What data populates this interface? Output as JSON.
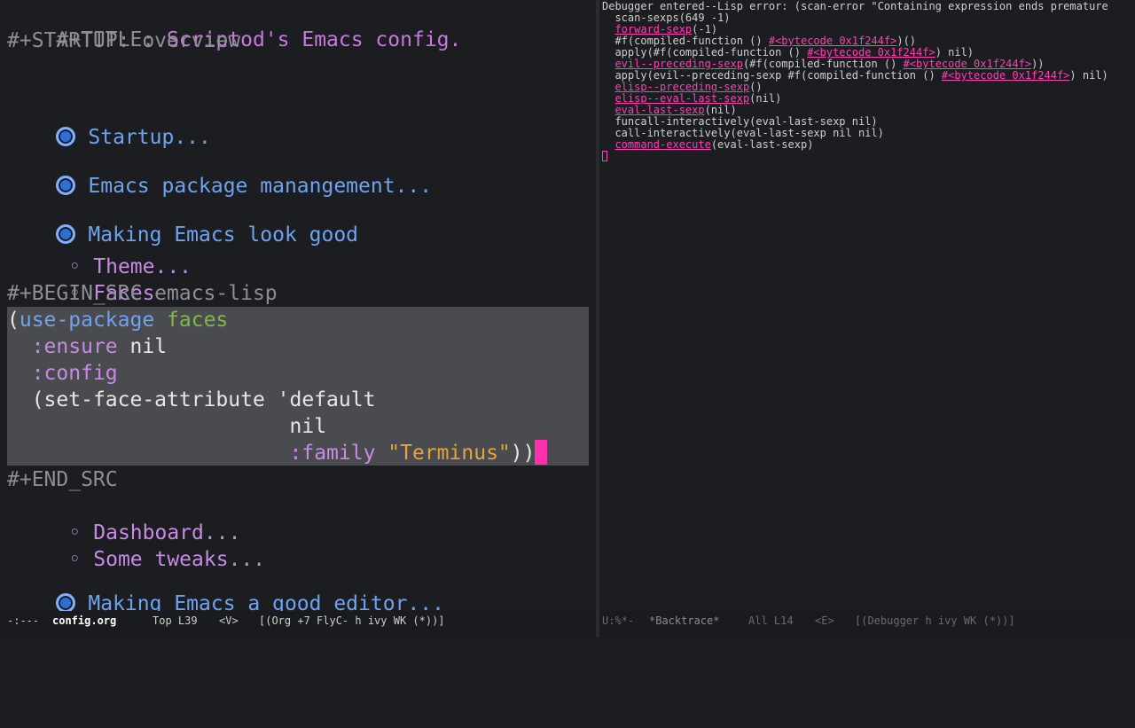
{
  "org": {
    "title_key": "#+TITLE:",
    "title_value": "Scriptod's Emacs config.",
    "startup": "#+STARTUP: overview",
    "headings": {
      "startup": "Startup...",
      "package_management": "Emacs package manangement...",
      "look_good": "Making Emacs look good",
      "theme": "Theme...",
      "faces": "Faces",
      "dashboard": "Dashboard...",
      "tweaks": "Some tweaks...",
      "editor": "Making Emacs a good editor..."
    },
    "begin_src": "#+BEGIN_SRC emacs-lisp",
    "end_src": "#+END_SRC",
    "bullet2_glyph": "◦",
    "code": {
      "open_paren": "(",
      "use_package": "use-package",
      "pkg_name": "faces",
      "ensure_kw": ":ensure",
      "ensure_val": "nil",
      "config_kw": ":config",
      "set_face": "(set-face-attribute 'default",
      "nil_line": "nil",
      "family_kw": ":family",
      "family_val": "\"Terminus\"",
      "close_parens": "))"
    }
  },
  "backtrace": {
    "header": "Debugger entered--Lisp error: (scan-error \"Containing expression ends premature",
    "lines": [
      {
        "pre": "  scan-sexps(649 -1)",
        "link": "",
        "post": ""
      },
      {
        "pre": "  ",
        "link": "forward-sexp",
        "post": "(-1)"
      },
      {
        "pre": "  #f(compiled-function () ",
        "link": "#<bytecode 0x1f244f>",
        "post": ")()"
      },
      {
        "pre": "  apply(#f(compiled-function () ",
        "link": "#<bytecode 0x1f244f>",
        "post": ") nil)"
      },
      {
        "pre": "  ",
        "link": "evil--preceding-sexp",
        "post": "(#f(compiled-function () ",
        "link2": "#<bytecode 0x1f244f>",
        "post2": "))"
      },
      {
        "pre": "  apply(evil--preceding-sexp #f(compiled-function () ",
        "link": "#<bytecode 0x1f244f>",
        "post": ") nil)"
      },
      {
        "pre": "  ",
        "link": "elisp--preceding-sexp",
        "post": "()"
      },
      {
        "pre": "  ",
        "link": "elisp--eval-last-sexp",
        "post": "(nil)"
      },
      {
        "pre": "  ",
        "link": "eval-last-sexp",
        "post": "(nil)"
      },
      {
        "pre": "  funcall-interactively(eval-last-sexp nil)",
        "link": "",
        "post": ""
      },
      {
        "pre": "  call-interactively(eval-last-sexp nil nil)",
        "link": "",
        "post": ""
      },
      {
        "pre": "  ",
        "link": "command-execute",
        "post": "(eval-last-sexp)"
      }
    ]
  },
  "modeline_left": {
    "status": "-:---",
    "buffer": "config.org",
    "position": "Top L39",
    "evil_state": "<V>",
    "modes": "[(Org +7 FlyC- h ivy WK (*))]"
  },
  "modeline_right": {
    "status": "U:%*-",
    "buffer": "*Backtrace*",
    "position": "All L14",
    "evil_state": "<E>",
    "modes": "[(Debugger h ivy WK (*))]"
  }
}
